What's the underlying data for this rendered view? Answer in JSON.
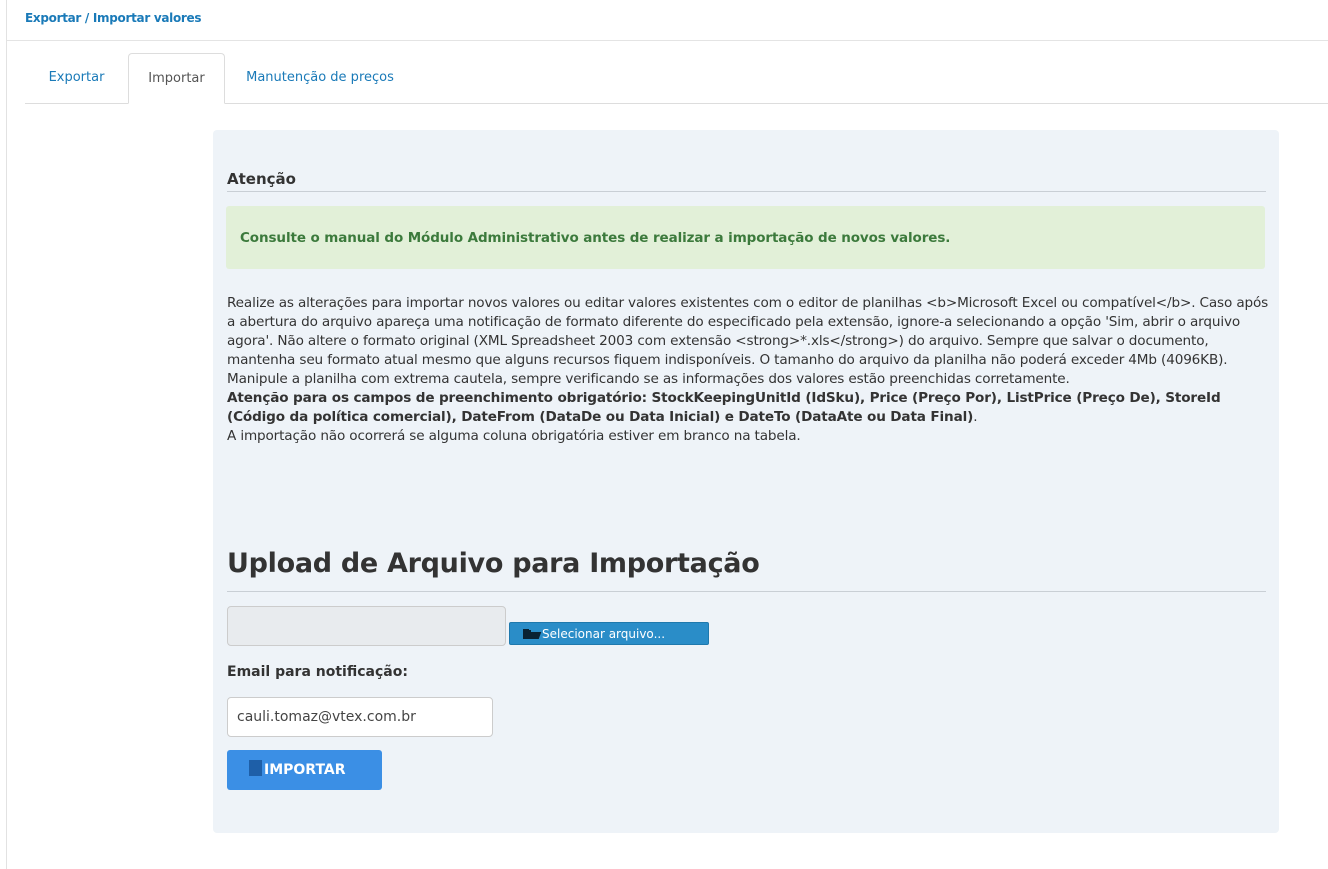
{
  "breadcrumb": {
    "text": "Exportar / Importar valores"
  },
  "tabs": [
    {
      "label": "Exportar",
      "active": false
    },
    {
      "label": "Importar",
      "active": true
    },
    {
      "label": "Manutenção de preços",
      "active": false
    }
  ],
  "attention": {
    "title": "Atenção",
    "alert_text": "Consulte o manual do Módulo Administrativo antes de realizar a importação de novos valores."
  },
  "description": {
    "paragraph": "Realize as alterações para importar novos valores ou editar valores existentes com o editor de planilhas <b>Microsoft Excel ou compatível</b>. Caso após a abertura do arquivo apareça uma notificação de formato diferente do especificado pela extensão, ignore-a selecionando a opção 'Sim, abrir o arquivo agora'. Não altere o formato original (XML Spreadsheet 2003 com extensão <strong>*.xls</strong>) do arquivo. Sempre que salvar o documento, mantenha seu formato atual mesmo que alguns recursos fiquem indisponíveis. O tamanho do arquivo da planilha não poderá exceder 4Mb (4096KB). Manipule a planilha com extrema cautela, sempre verificando se as informações dos valores estão preenchidas corretamente.",
    "required_fields": "Atenção para os campos de preenchimento obrigatório: StockKeepingUnitId (IdSku), Price (Preço Por), ListPrice (Preço De), StoreId (Código da política comercial), DateFrom (DataDe ou Data Inicial) e DateTo (DataAte ou Data Final)",
    "required_suffix": ".",
    "note": "A importação não ocorrerá se alguma coluna obrigatória estiver em branco na tabela."
  },
  "upload": {
    "title": "Upload de Arquivo para Importação",
    "file_value": "",
    "select_button": "Selecionar arquivo...",
    "select_icon": "folder-open-icon"
  },
  "email": {
    "label": "Email para notificação:",
    "value": "cauli.tomaz@vtex.com.br"
  },
  "import_button": {
    "label": "IMPORTAR",
    "icon": "import-icon"
  },
  "colors": {
    "link": "#1a7ab8",
    "panel_bg": "#eef3f8",
    "alert_bg": "#e2f0d8",
    "alert_text": "#3c7a3c",
    "primary_button": "#3b8fe5",
    "file_button": "#2a8dc8"
  }
}
